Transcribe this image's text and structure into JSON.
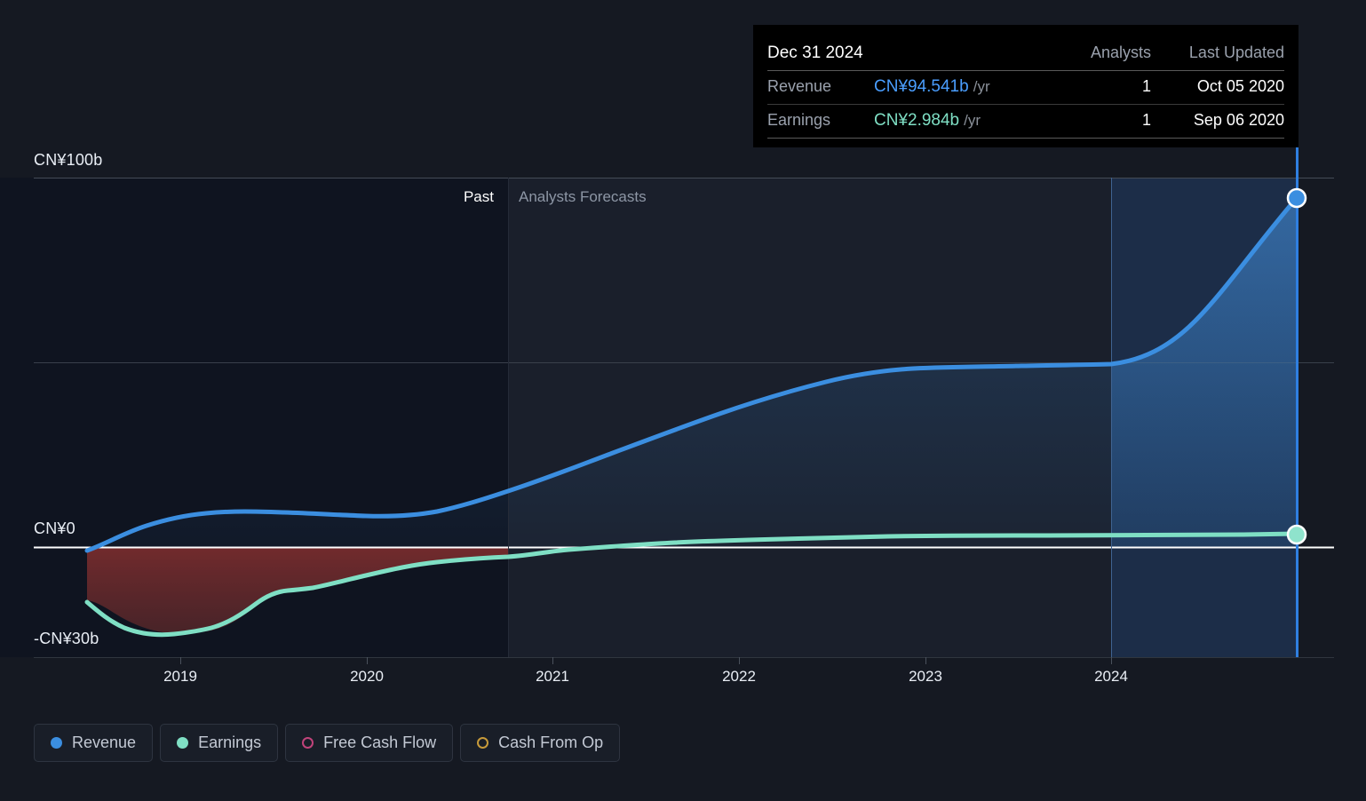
{
  "theme": {
    "background": "#151922",
    "past_band": "#101420",
    "forecast_band": "#1a1f2b",
    "highlight_band": "#1d3a5f",
    "revenue_color": "#3b8ee0",
    "earnings_color": "#7fdfc4",
    "fcf_color": "#c0437a",
    "cfo_color": "#c79a3a",
    "zero_line": "#ffffff",
    "grid_line": "#3a4049",
    "cursor_line": "#2f7fe0",
    "negative_fill": "#6b3030",
    "tooltip_bg": "#000000"
  },
  "axes": {
    "y_top_label": "CN¥100b",
    "y_zero_label": "CN¥0",
    "y_bottom_label": "-CN¥30b",
    "x_labels": [
      "2019",
      "2020",
      "2021",
      "2022",
      "2023",
      "2024"
    ]
  },
  "bands": {
    "past_label": "Past",
    "forecast_label": "Analysts Forecasts"
  },
  "tooltip": {
    "date": "Dec 31 2024",
    "header_analysts": "Analysts",
    "header_last_updated": "Last Updated",
    "rows": [
      {
        "metric": "Revenue",
        "value": "CN¥94.541b",
        "unit": "/yr",
        "analysts": "1",
        "last_updated": "Oct 05 2020"
      },
      {
        "metric": "Earnings",
        "value": "CN¥2.984b",
        "unit": "/yr",
        "analysts": "1",
        "last_updated": "Sep 06 2020"
      }
    ]
  },
  "legend": {
    "items": [
      {
        "label": "Revenue",
        "color": "#3b8ee0",
        "style": "filled",
        "icon": "circle-filled-icon",
        "active": true
      },
      {
        "label": "Earnings",
        "color": "#7fdfc4",
        "style": "filled",
        "icon": "circle-filled-icon",
        "active": true
      },
      {
        "label": "Free Cash Flow",
        "color": "#c0437a",
        "style": "hollow",
        "icon": "circle-outline-icon",
        "active": false
      },
      {
        "label": "Cash From Op",
        "color": "#c79a3a",
        "style": "hollow",
        "icon": "circle-outline-icon",
        "active": false
      }
    ]
  },
  "chart_data": {
    "type": "area",
    "title": "Revenue and Earnings Growth",
    "xlabel": "",
    "ylabel": "CN¥",
    "ylim": [
      -30,
      100
    ],
    "currency": "CN¥",
    "unit": "b",
    "grid": true,
    "legend_position": "bottom-left",
    "x_tick_labels": [
      "2019",
      "2020",
      "2021",
      "2022",
      "2023",
      "2024"
    ],
    "y_tick_labels": [
      "CN¥100b",
      "CN¥0",
      "-CN¥30b"
    ],
    "past_forecast_split": "2020-09",
    "annotations": [
      "Past",
      "Analysts Forecasts"
    ],
    "highlight_point": {
      "x": "Dec 31 2024",
      "revenue": 94.541,
      "earnings": 2.984
    },
    "x": [
      "2018-07",
      "2018-10",
      "2019-01",
      "2019-04",
      "2019-07",
      "2019-10",
      "2020-01",
      "2020-04",
      "2020-07",
      "2020-10",
      "2021-01",
      "2021-04",
      "2021-07",
      "2021-10",
      "2022-01",
      "2022-04",
      "2022-07",
      "2022-10",
      "2023-01",
      "2023-04",
      "2023-07",
      "2023-10",
      "2024-01",
      "2024-04",
      "2024-07",
      "2024-10",
      "2024-12"
    ],
    "series": [
      {
        "name": "Revenue",
        "color": "#3b8ee0",
        "values": [
          -0.5,
          1.5,
          3.3,
          3.8,
          3.9,
          3.6,
          3.3,
          3.4,
          4.2,
          6.5,
          10.0,
          14.0,
          18.5,
          23.5,
          28.0,
          32.5,
          37.0,
          42.0,
          46.0,
          47.6,
          48.0,
          48.2,
          48.5,
          49.0,
          56.0,
          75.0,
          94.541
        ]
      },
      {
        "name": "Earnings",
        "color": "#7fdfc4",
        "values": [
          -18.0,
          -24.5,
          -27.5,
          -28.2,
          -28.0,
          -27.0,
          -22.0,
          -17.5,
          -16.8,
          -16.0,
          -14.0,
          -11.5,
          -9.5,
          -8.0,
          -7.0,
          -6.0,
          -5.0,
          -4.0,
          -3.2,
          -2.6,
          -2.2,
          -1.8,
          -1.4,
          -1.0,
          -0.4,
          1.2,
          2.984
        ]
      }
    ]
  }
}
